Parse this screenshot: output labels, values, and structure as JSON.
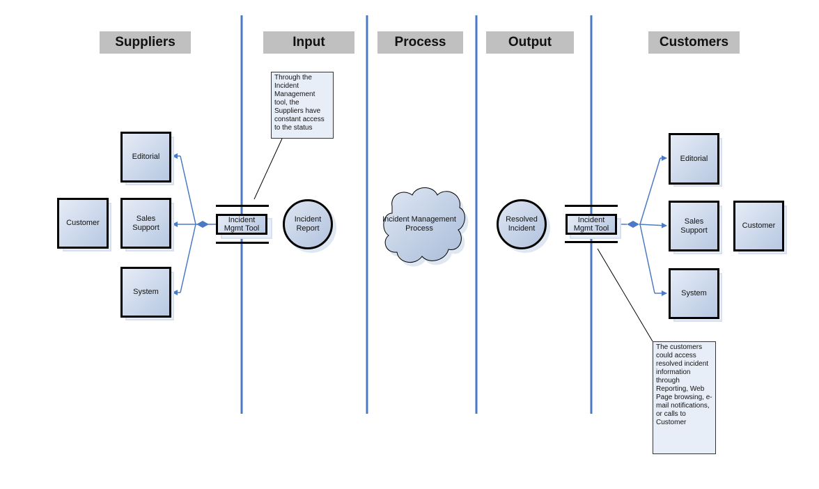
{
  "diagram": {
    "type": "SIPOC",
    "headers": {
      "suppliers": "Suppliers",
      "input": "Input",
      "process": "Process",
      "output": "Output",
      "customers": "Customers"
    },
    "suppliers": {
      "editorial": "Editorial",
      "sales_support": "Sales Support",
      "system": "System",
      "customer": "Customer"
    },
    "input": {
      "tool": "Incident Mgmt Tool",
      "report": "Incident Report",
      "note": "Through the Incident Management tool, the Suppliers have constant access to the status"
    },
    "process": {
      "label": "Incident Management Process"
    },
    "output": {
      "resolved": "Resolved Incident",
      "tool": "Incident Mgmt Tool",
      "note": "The customers could access resolved incident information through Reporting, Web Page browsing, e-mail notifications, or calls to Customer"
    },
    "customers": {
      "editorial": "Editorial",
      "sales_support": "Sales Support",
      "system": "System",
      "customer": "Customer"
    },
    "colors": {
      "divider": "#4a7ac4",
      "connector": "#4a7ac4",
      "header_bg": "#c0c0c0",
      "shape_fill": "#b7c8e2"
    }
  }
}
